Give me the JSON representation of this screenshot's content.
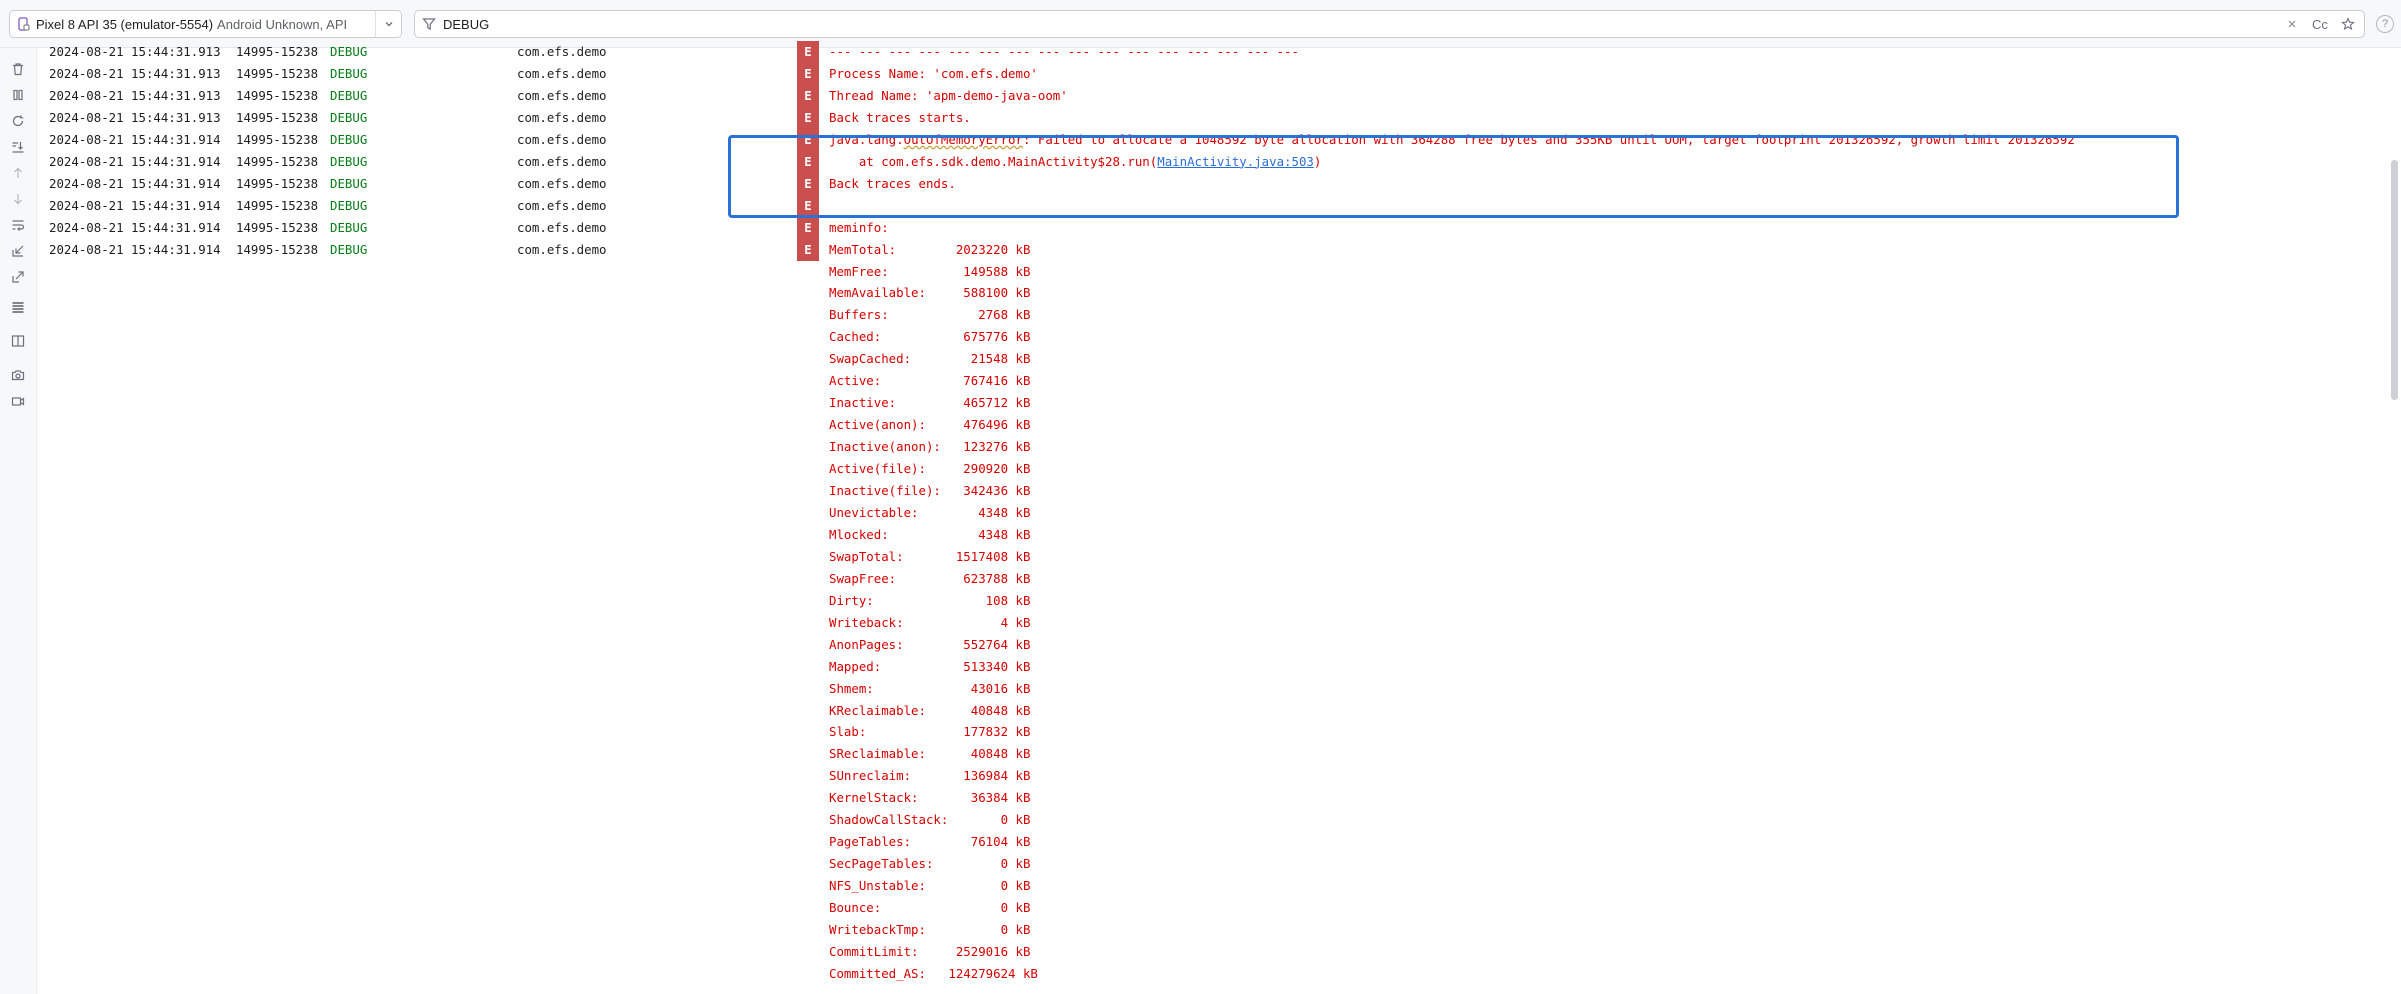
{
  "toolbar": {
    "device_name": "Pixel 8 API 35 (emulator-5554)",
    "device_info": "Android Unknown, API",
    "filter_text": "DEBUG",
    "case_label": "Cc",
    "help_label": "?"
  },
  "sidebar": {
    "icons": [
      "trash-icon",
      "pause-icon",
      "restart-icon",
      "scroll-to-end-icon",
      "up-arrow-icon",
      "down-arrow-icon",
      "soft-wrap-icon",
      "import-icon",
      "export-icon",
      "format-icon",
      "split-panels-icon",
      "screenshot-icon",
      "screen-record-icon"
    ]
  },
  "log": {
    "level_label": "E",
    "rows": [
      {
        "ts": "2024-08-21 15:44:31.913",
        "pid": "14995-15238",
        "tag": "DEBUG",
        "pkg": "com.efs.demo",
        "msg": "--- --- --- --- --- --- --- --- --- --- --- --- --- --- --- ---"
      },
      {
        "ts": "2024-08-21 15:44:31.913",
        "pid": "14995-15238",
        "tag": "DEBUG",
        "pkg": "com.efs.demo",
        "msg": "Process Name: 'com.efs.demo'"
      },
      {
        "ts": "2024-08-21 15:44:31.913",
        "pid": "14995-15238",
        "tag": "DEBUG",
        "pkg": "com.efs.demo",
        "msg": "Thread Name: 'apm-demo-java-oom'"
      },
      {
        "ts": "2024-08-21 15:44:31.913",
        "pid": "14995-15238",
        "tag": "DEBUG",
        "pkg": "com.efs.demo",
        "msg": "Back traces starts."
      },
      {
        "ts": "2024-08-21 15:44:31.914",
        "pid": "14995-15238",
        "tag": "DEBUG",
        "pkg": "com.efs.demo",
        "msg_prefix": "java.lang.",
        "msg_squig": "OutOfMemoryError",
        "msg_suffix": ": Failed to allocate a 1048592 byte allocation with 364288 free bytes and 355KB until OOM, target footprint 201326592, growth limit 201326592"
      },
      {
        "ts": "2024-08-21 15:44:31.914",
        "pid": "14995-15238",
        "tag": "DEBUG",
        "pkg": "com.efs.demo",
        "msg_prefix": "    at com.efs.sdk.demo.MainActivity$28.run(",
        "msg_link": "MainActivity.java:503",
        "msg_suffix": ")"
      },
      {
        "ts": "2024-08-21 15:44:31.914",
        "pid": "14995-15238",
        "tag": "DEBUG",
        "pkg": "com.efs.demo",
        "msg": "Back traces ends."
      },
      {
        "ts": "2024-08-21 15:44:31.914",
        "pid": "14995-15238",
        "tag": "DEBUG",
        "pkg": "com.efs.demo",
        "msg": ""
      },
      {
        "ts": "2024-08-21 15:44:31.914",
        "pid": "14995-15238",
        "tag": "DEBUG",
        "pkg": "com.efs.demo",
        "msg": "meminfo:"
      },
      {
        "ts": "2024-08-21 15:44:31.914",
        "pid": "14995-15238",
        "tag": "DEBUG",
        "pkg": "com.efs.demo",
        "msg": "MemTotal:        2023220 kB"
      }
    ],
    "meminfo": [
      "MemFree:          149588 kB",
      "MemAvailable:     588100 kB",
      "Buffers:            2768 kB",
      "Cached:           675776 kB",
      "SwapCached:        21548 kB",
      "Active:           767416 kB",
      "Inactive:         465712 kB",
      "Active(anon):     476496 kB",
      "Inactive(anon):   123276 kB",
      "Active(file):     290920 kB",
      "Inactive(file):   342436 kB",
      "Unevictable:        4348 kB",
      "Mlocked:            4348 kB",
      "SwapTotal:       1517408 kB",
      "SwapFree:         623788 kB",
      "Dirty:               108 kB",
      "Writeback:             4 kB",
      "AnonPages:        552764 kB",
      "Mapped:           513340 kB",
      "Shmem:             43016 kB",
      "KReclaimable:      40848 kB",
      "Slab:             177832 kB",
      "SReclaimable:      40848 kB",
      "SUnreclaim:       136984 kB",
      "KernelStack:       36384 kB",
      "ShadowCallStack:       0 kB",
      "PageTables:        76104 kB",
      "SecPageTables:         0 kB",
      "NFS_Unstable:          0 kB",
      "Bounce:                0 kB",
      "WritebackTmp:          0 kB",
      "CommitLimit:     2529016 kB",
      "Committed_AS:   124279624 kB"
    ]
  },
  "colors": {
    "error_text": "#d70000",
    "level_badge": "#c94f4f",
    "debug_tag": "#067d17",
    "highlight": "#2a72d4",
    "link": "#2a6ed6"
  }
}
